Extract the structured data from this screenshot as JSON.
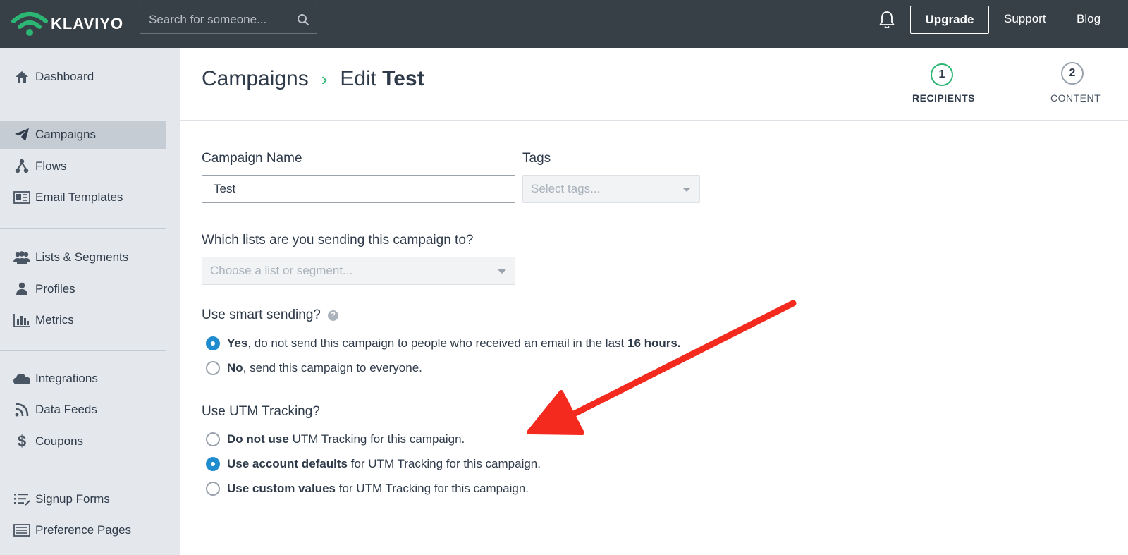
{
  "brand": {
    "name": "KLAVIYO"
  },
  "topbar": {
    "search_placeholder": "Search for someone...",
    "upgrade_label": "Upgrade",
    "support_label": "Support",
    "blog_label": "Blog"
  },
  "sidebar": {
    "items": [
      {
        "label": "Dashboard",
        "icon": "home-icon"
      },
      {
        "label": "Campaigns",
        "icon": "paper-plane-icon",
        "active": true
      },
      {
        "label": "Flows",
        "icon": "flows-icon"
      },
      {
        "label": "Email Templates",
        "icon": "template-icon"
      },
      {
        "label": "Lists & Segments",
        "icon": "users-icon"
      },
      {
        "label": "Profiles",
        "icon": "user-icon"
      },
      {
        "label": "Metrics",
        "icon": "bar-chart-icon"
      },
      {
        "label": "Integrations",
        "icon": "cloud-icon"
      },
      {
        "label": "Data Feeds",
        "icon": "rss-icon"
      },
      {
        "label": "Coupons",
        "icon": "dollar-icon"
      },
      {
        "label": "Signup Forms",
        "icon": "list-icon"
      },
      {
        "label": "Preference Pages",
        "icon": "page-icon"
      }
    ]
  },
  "breadcrumb": {
    "parent": "Campaigns",
    "separator": "›",
    "edit_prefix": "Edit",
    "name": "Test"
  },
  "steps": [
    {
      "number": "1",
      "label": "RECIPIENTS",
      "active": true
    },
    {
      "number": "2",
      "label": "CONTENT",
      "active": false
    }
  ],
  "form": {
    "campaign_name_label": "Campaign Name",
    "campaign_name_value": "Test",
    "tags_label": "Tags",
    "tags_placeholder": "Select tags...",
    "lists_label": "Which lists are you sending this campaign to?",
    "lists_placeholder": "Choose a list or segment...",
    "smart_sending_label": "Use smart sending?",
    "smart_sending_help": "?",
    "smart_yes_bold": "Yes",
    "smart_yes_text": ", do not send this campaign to people who received an email in the last ",
    "smart_yes_hours": "16 hours.",
    "smart_no_bold": "No",
    "smart_no_text": ", send this campaign to everyone.",
    "utm_label": "Use UTM Tracking?",
    "utm_options": [
      {
        "bold": "Do not use",
        "text": " UTM Tracking for this campaign.",
        "checked": false
      },
      {
        "bold": "Use account defaults",
        "text": " for UTM Tracking for this campaign.",
        "checked": true
      },
      {
        "bold": "Use custom values",
        "text": " for UTM Tracking for this campaign.",
        "checked": false
      }
    ]
  },
  "colors": {
    "topbar": "#373f47",
    "sidebar": "#e4e8ec",
    "accent_green": "#2bb673",
    "radio_blue": "#1f8ccf",
    "arrow_red": "#f42a1e"
  }
}
